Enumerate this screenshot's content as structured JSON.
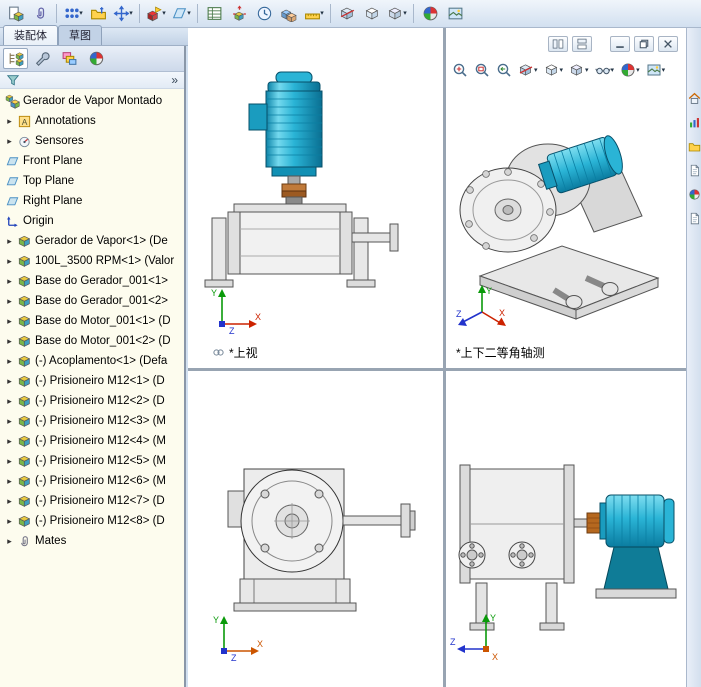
{
  "tabs": [
    {
      "label": "装配体",
      "active": true
    },
    {
      "label": "草图",
      "active": false
    }
  ],
  "toolbar": {
    "items": [
      {
        "icon": "insert-component"
      },
      {
        "icon": "mate"
      },
      {
        "sep": true
      },
      {
        "icon": "linear-pattern",
        "caret": true
      },
      {
        "icon": "smart-fasteners"
      },
      {
        "icon": "move-component",
        "caret": true
      },
      {
        "sep": true
      },
      {
        "icon": "assembly-feature",
        "caret": true
      },
      {
        "icon": "reference-geometry",
        "caret": true
      },
      {
        "sep": true
      },
      {
        "icon": "bom"
      },
      {
        "icon": "exploded-view"
      },
      {
        "icon": "motion-study"
      },
      {
        "icon": "interference"
      },
      {
        "icon": "measure",
        "caret": true
      },
      {
        "sep": true
      },
      {
        "icon": "section-view"
      },
      {
        "icon": "view-cube"
      },
      {
        "icon": "display-cube",
        "caret": true
      },
      {
        "sep": true
      },
      {
        "icon": "appearance"
      },
      {
        "icon": "scene"
      }
    ]
  },
  "panel": {
    "chevron": "»",
    "tabs": [
      {
        "icon": "pt-tree",
        "name": "featuremanager-tab"
      },
      {
        "icon": "pt-prop",
        "name": "propertymanager-tab"
      },
      {
        "icon": "pt-config",
        "name": "configurationmanager-tab"
      },
      {
        "icon": "pt-appearance",
        "name": "displaymanager-tab"
      }
    ]
  },
  "tree": {
    "root": {
      "label": "Gerador de Vapor Montado",
      "icon": "asm"
    },
    "items": [
      {
        "label": "Annotations",
        "icon": "ann",
        "expand": true
      },
      {
        "label": "Sensores",
        "icon": "sen",
        "expand": true
      },
      {
        "label": "Front Plane",
        "icon": "pln",
        "expand": false
      },
      {
        "label": "Top Plane",
        "icon": "pln",
        "expand": false
      },
      {
        "label": "Right Plane",
        "icon": "pln",
        "expand": false
      },
      {
        "label": "Origin",
        "icon": "org",
        "expand": false
      },
      {
        "label": "Gerador de Vapor<1> (De",
        "icon": "cmp",
        "expand": true
      },
      {
        "label": "100L_3500 RPM<1> (Valor",
        "icon": "cmp",
        "expand": true
      },
      {
        "label": "Base do Gerador_001<1>",
        "icon": "cmp",
        "expand": true
      },
      {
        "label": "Base do Gerador_001<2>",
        "icon": "cmp",
        "expand": true
      },
      {
        "label": "Base do Motor_001<1> (D",
        "icon": "cmp",
        "expand": true
      },
      {
        "label": "Base do Motor_001<2> (D",
        "icon": "cmp",
        "expand": true
      },
      {
        "label": "(-) Acoplamento<1> (Defa",
        "icon": "cmp",
        "expand": true
      },
      {
        "label": "(-) Prisioneiro M12<1> (D",
        "icon": "cmp",
        "expand": true
      },
      {
        "label": "(-) Prisioneiro M12<2> (D",
        "icon": "cmp",
        "expand": true
      },
      {
        "label": "(-) Prisioneiro M12<3> (M",
        "icon": "cmp",
        "expand": true
      },
      {
        "label": "(-) Prisioneiro M12<4> (M",
        "icon": "cmp",
        "expand": true
      },
      {
        "label": "(-) Prisioneiro M12<5> (M",
        "icon": "cmp",
        "expand": true
      },
      {
        "label": "(-) Prisioneiro M12<6> (M",
        "icon": "cmp",
        "expand": true
      },
      {
        "label": "(-) Prisioneiro M12<7> (D",
        "icon": "cmp",
        "expand": true
      },
      {
        "label": "(-) Prisioneiro M12<8> (D",
        "icon": "cmp",
        "expand": true
      },
      {
        "label": "Mates",
        "icon": "mat",
        "expand": true
      }
    ]
  },
  "viewport": {
    "window_controls": [
      {
        "icon": "tile-v",
        "name": "previous-window-button"
      },
      {
        "icon": "tile-h",
        "name": "next-window-button"
      },
      {
        "icon": "minimize",
        "name": "minimize-button",
        "gap": true
      },
      {
        "icon": "restore",
        "name": "restore-button"
      },
      {
        "icon": "close",
        "name": "close-button"
      }
    ],
    "headsup": [
      {
        "icon": "zoom-fit"
      },
      {
        "icon": "zoom-area"
      },
      {
        "icon": "zoom-prev"
      },
      {
        "icon": "section-view",
        "caret": true
      },
      {
        "icon": "view-cube",
        "caret": true
      },
      {
        "icon": "display-cube",
        "caret": true
      },
      {
        "icon": "glasses",
        "caret": true
      },
      {
        "icon": "appearance",
        "caret": true
      },
      {
        "icon": "scene",
        "caret": true
      }
    ],
    "views": {
      "top_left": {
        "label": "*上视"
      },
      "top_right": {
        "label": "*上下二等角轴测"
      },
      "bottom_left": {
        "label": ""
      },
      "bottom_right": {
        "label": ""
      }
    },
    "axes": {
      "x": "X",
      "y": "Y",
      "z": "Z"
    }
  },
  "taskpane": {
    "icons": [
      {
        "icon": "home",
        "name": "taskpane-home-tab"
      },
      {
        "icon": "bars",
        "name": "taskpane-resources-tab"
      },
      {
        "icon": "folder",
        "name": "taskpane-library-tab"
      },
      {
        "icon": "doc",
        "name": "taskpane-palette-tab"
      },
      {
        "icon": "pt-appearance",
        "name": "taskpane-appearances-tab"
      },
      {
        "icon": "doc",
        "name": "taskpane-properties-tab"
      }
    ]
  }
}
